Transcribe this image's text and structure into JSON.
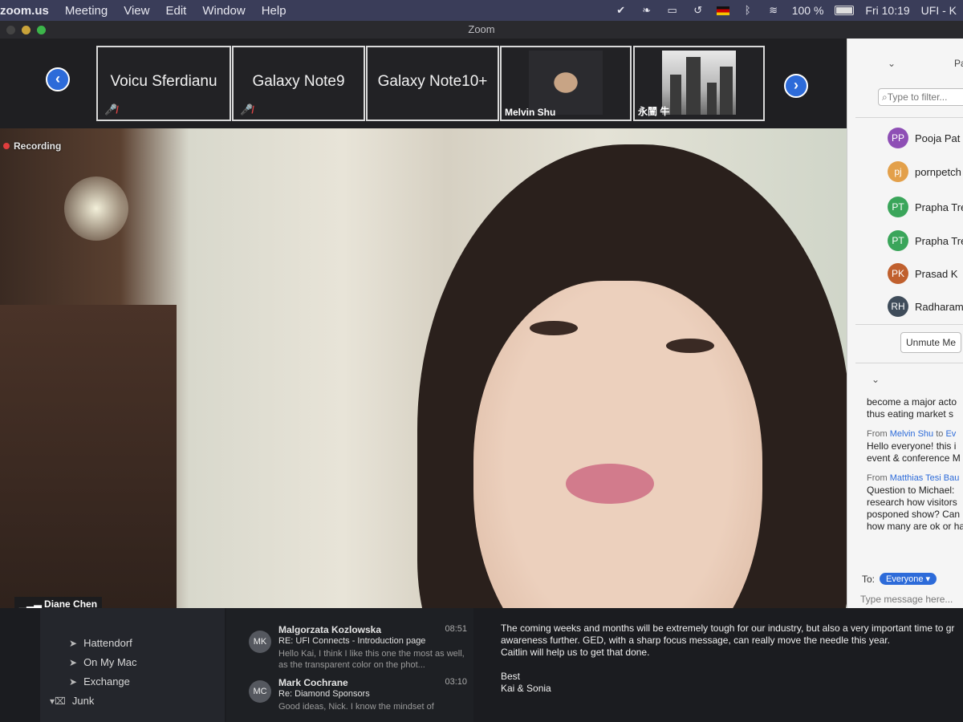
{
  "menubar": {
    "app": "zoom.us",
    "items": [
      "Meeting",
      "View",
      "Edit",
      "Window",
      "Help"
    ],
    "battery": "100 %",
    "clock": "Fri 10:19",
    "user": "UFI - K"
  },
  "window": {
    "title": "Zoom"
  },
  "thumbnails": [
    {
      "name": "Voicu Sferdianu",
      "muted": true
    },
    {
      "name": "Galaxy Note9",
      "muted": true
    },
    {
      "name": "Galaxy Note10+",
      "muted": false
    },
    {
      "name": "Melvin Shu",
      "video": true
    },
    {
      "name": "永闓 牛",
      "video": true
    }
  ],
  "main_video": {
    "recording_label": "Recording",
    "speaker_name": "Diane Chen"
  },
  "participants": {
    "header": "Pa",
    "filter_placeholder": "Type to filter...",
    "list": [
      {
        "initials": "PP",
        "name": "Pooja Pat",
        "color": "#8e4fb5"
      },
      {
        "initials": "pj",
        "name": "pornpetch",
        "color": "#e3a04a"
      },
      {
        "initials": "PT",
        "name": "Prapha Tre",
        "color": "#3aa55a"
      },
      {
        "initials": "PT",
        "name": "Prapha Tre",
        "color": "#3aa55a"
      },
      {
        "initials": "PK",
        "name": "Prasad K",
        "color": "#c0602e"
      },
      {
        "initials": "RH",
        "name": "Radharama",
        "color": "#3f4c5a"
      }
    ],
    "unmute_label": "Unmute Me"
  },
  "chat": {
    "messages": [
      {
        "from": "",
        "to": "",
        "lines": [
          "become a major acto",
          "thus eating market s"
        ]
      },
      {
        "from": "Melvin Shu",
        "to": "Ev",
        "lines": [
          "Hello everyone! this i",
          "event & conference M"
        ]
      },
      {
        "from": "Matthias Tesi Bau",
        "to": "",
        "lines": [
          "Question to Michael:",
          "research how visitors",
          "posponed show? Can",
          "how many are ok or ha"
        ]
      }
    ],
    "to_label": "To:",
    "to_value": "Everyone",
    "input_placeholder": "Type message here..."
  },
  "mail": {
    "folders": [
      "Hattendorf",
      "On My Mac",
      "Exchange",
      "Junk"
    ],
    "messages": [
      {
        "initials": "MK",
        "sender": "Malgorzata Kozlowska",
        "time": "08:51",
        "subject": "RE: UFI Connects - Introduction page",
        "preview": "Hello Kai, I think I like this one the most as well, as the transparent color on the phot..."
      },
      {
        "initials": "MC",
        "sender": "Mark Cochrane",
        "time": "03:10",
        "subject": "Re: Diamond Sponsors",
        "preview": "Good ideas, Nick. I know the mindset of"
      }
    ],
    "body": [
      "The coming weeks and months will be extremely tough for our industry, but also a very important time to gr",
      "awareness further. GED, with a sharp focus message, can really move the needle this year.",
      "Caitlin will help us to get that done.",
      "",
      "Best",
      "Kai & Sonia"
    ]
  }
}
